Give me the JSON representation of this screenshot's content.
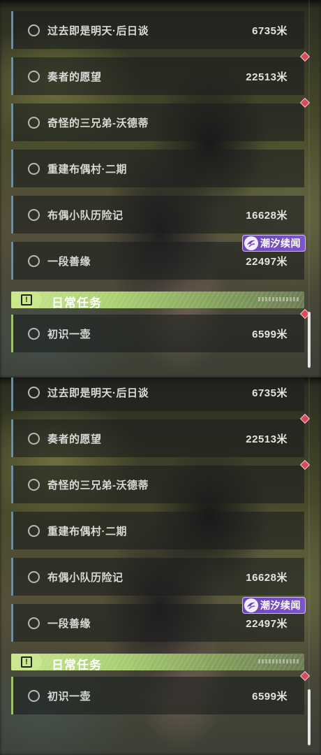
{
  "quests": [
    {
      "title": "过去即是明天·后日谈",
      "distance": "6735米",
      "mark": false,
      "badge": null
    },
    {
      "title": "奏者的愿望",
      "distance": "22513米",
      "mark": true,
      "badge": null
    },
    {
      "title": "奇怪的三兄弟-沃德蒂",
      "distance": "",
      "mark": true,
      "badge": null
    },
    {
      "title": "重建布偶村·二期",
      "distance": "",
      "mark": false,
      "badge": null
    },
    {
      "title": "布偶小队历险记",
      "distance": "16628米",
      "mark": false,
      "badge": null
    },
    {
      "title": "一段善缘",
      "distance": "22497米",
      "mark": false,
      "badge": "潮汐续闻"
    }
  ],
  "daily_section": {
    "title": "日常任务",
    "icon": "exclamation-box-icon"
  },
  "daily_quests": [
    {
      "title": "初识一壶",
      "distance": "6599米",
      "mark": true
    }
  ],
  "colors": {
    "main_quest_bar": "#6f8c99",
    "daily_quest_bar": "#9fc26a",
    "mark": "#d8495a",
    "badge": "#6c46b8",
    "section_header": "#c7e58e"
  }
}
